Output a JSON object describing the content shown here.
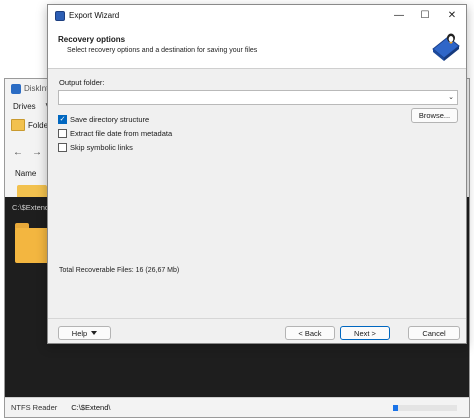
{
  "background_app": {
    "title": "DiskInter",
    "menu": [
      "Drives",
      "V"
    ],
    "toolbar_label": "Folde",
    "nav_back": "←",
    "nav_forward": "→",
    "nav_down": "⌄",
    "nav_refresh": "⟳",
    "column_header": "Name",
    "dark_pane_path": "C:\\$Extend\\",
    "status_left": "NTFS Reader",
    "status_path": "C:\\$Extend\\",
    "progress": 0.08
  },
  "wizard": {
    "title": "Export Wizard",
    "window_controls": {
      "minimize": "—",
      "maximize": "☐",
      "close": "✕"
    },
    "header_title": "Recovery options",
    "header_subtitle": "Select recovery options and a destination for saving your files",
    "output_folder_label": "Output folder:",
    "output_folder_value": "",
    "dropdown_glyph": "⌄",
    "browse_label": "Browse...",
    "options": [
      {
        "label": "Save directory structure",
        "checked": true
      },
      {
        "label": "Extract file date from metadata",
        "checked": false
      },
      {
        "label": "Skip symbolic links",
        "checked": false
      }
    ],
    "total_files": "Total Recoverable Files: 16 (26,67 Mb)",
    "buttons": {
      "help": "Help",
      "back": "< Back",
      "next": "Next >",
      "cancel": "Cancel"
    }
  },
  "colors": {
    "accent": "#0067c0",
    "folder": "#f3b640",
    "dark_pane": "#1e1e1e"
  }
}
